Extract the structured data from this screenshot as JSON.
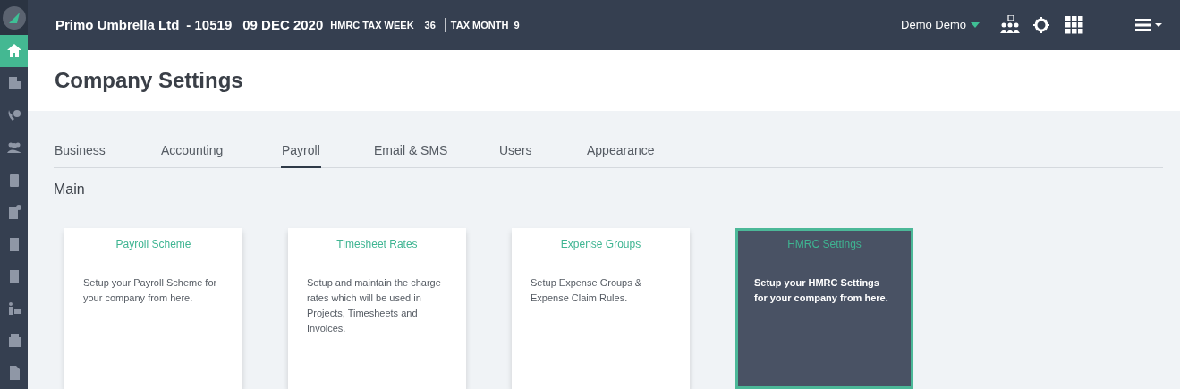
{
  "header": {
    "company": "Primo Umbrella Ltd",
    "company_code": "- 10519",
    "date": "09 DEC 2020",
    "tax_week_label": "HMRC TAX WEEK",
    "tax_week": "36",
    "tax_month_label": "TAX MONTH",
    "tax_month": "9",
    "user": "Demo Demo"
  },
  "sidebar": {
    "items": [
      {
        "selected": true
      },
      {
        "selected": false
      },
      {
        "selected": false
      },
      {
        "selected": false
      },
      {
        "selected": false
      },
      {
        "selected": false
      },
      {
        "selected": false
      },
      {
        "selected": false
      },
      {
        "selected": false
      },
      {
        "selected": false
      },
      {
        "selected": false
      }
    ]
  },
  "page_title": "Company Settings",
  "tabs": [
    {
      "label": "Business",
      "selected": false
    },
    {
      "label": "Accounting",
      "selected": false
    },
    {
      "label": "Payroll",
      "selected": true
    },
    {
      "label": "Email & SMS",
      "selected": false
    },
    {
      "label": "Users",
      "selected": false
    },
    {
      "label": "Appearance",
      "selected": false
    }
  ],
  "section_title": "Main",
  "cards": [
    {
      "title": "Payroll Scheme",
      "description": "Setup your Payroll Scheme for your company from here.",
      "selected": false
    },
    {
      "title": "Timesheet Rates",
      "description": "Setup and maintain the charge rates which will be used in Projects, Timesheets and Invoices.",
      "selected": false
    },
    {
      "title": "Expense Groups",
      "description": "Setup Expense Groups & Expense Claim Rules.",
      "selected": false
    },
    {
      "title": "HMRC Settings",
      "description": "Setup your HMRC Settings for your company from here.",
      "selected": true
    }
  ]
}
